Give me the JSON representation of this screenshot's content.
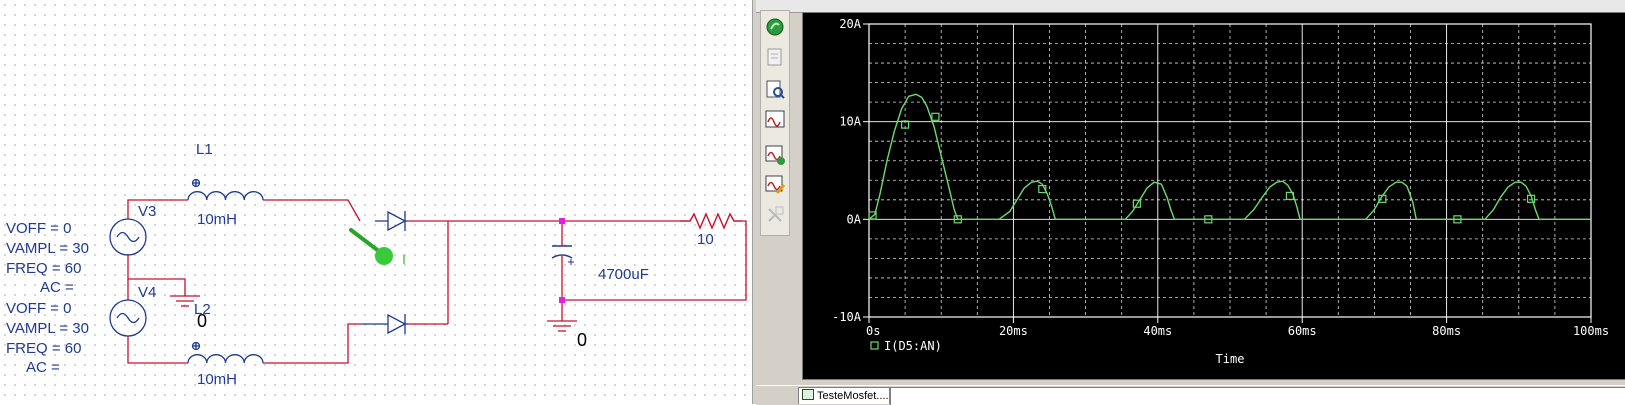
{
  "schematic": {
    "left_source_params": [
      "VOFF = 0",
      "VAMPL = 30",
      "FREQ = 60",
      "AC ="
    ],
    "left_source_params_2": [
      "VOFF = 0",
      "VAMPL = 30",
      "FREQ = 60",
      "AC ="
    ],
    "v3_label": "V3",
    "v4_label": "V4",
    "l1_name": "L1",
    "l1_value": "10mH",
    "l2_name": "L2",
    "l2_value": "10mH",
    "gnd_label_1": "0",
    "gnd_label_2": "0",
    "probe_label": "I",
    "cap_value": "4700uF",
    "res_value": "10",
    "wire_color": "#c8102e",
    "part_color": "#1f3a93",
    "probe_color": "#39c93a",
    "node_color": "#e020e0"
  },
  "toolbar": {
    "icons": [
      "run-sim-icon",
      "view-output-icon",
      "view-sim-results-icon",
      "add-trace-icon",
      "run-pspice-icon",
      "edit-profile-icon",
      "disabled-tool-icon"
    ]
  },
  "tabs": {
    "file_tab_label": "TesteMosfet...."
  },
  "chart_data": {
    "type": "line",
    "xlabel": "Time",
    "ylabel": "",
    "x_tick_labels": [
      "0s",
      "20ms",
      "40ms",
      "60ms",
      "80ms",
      "100ms"
    ],
    "y_tick_labels": [
      "-10A",
      "0A",
      "10A",
      "20A"
    ],
    "xlim": [
      0,
      100
    ],
    "ylim": [
      -10,
      20
    ],
    "grid": true,
    "legend_placement": "bottom-left",
    "background": "#000000",
    "trace_color": "#6bdc6b",
    "axis_color": "#ffffff",
    "series": [
      {
        "name": "I(D5:AN)",
        "x_ms": [
          0,
          0.8,
          1.5,
          2.5,
          3.5,
          4.5,
          5.5,
          6.5,
          7.3,
          8.0,
          9.0,
          10.0,
          11.0,
          11.8,
          12.3,
          12.8,
          18.0,
          19.5,
          20.5,
          21.5,
          22.5,
          23.3,
          24.0,
          24.7,
          25.3,
          25.8,
          35.5,
          36.5,
          37.5,
          38.5,
          39.5,
          40.5,
          41.3,
          41.8,
          42.3,
          52.0,
          53.3,
          54.5,
          55.5,
          56.5,
          57.3,
          58.0,
          58.7,
          59.3,
          59.7,
          68.8,
          70.0,
          71.0,
          72.0,
          73.0,
          73.8,
          74.5,
          75.3,
          75.8,
          85.3,
          86.5,
          87.5,
          88.5,
          89.5,
          90.3,
          91.0,
          91.7,
          92.3,
          92.8,
          100.0
        ],
        "y_amp": [
          0,
          0.5,
          2.5,
          6,
          9,
          11.3,
          12.6,
          12.8,
          12.5,
          11.6,
          9.5,
          6.5,
          3.5,
          1.0,
          0,
          0,
          0,
          0.8,
          2,
          3.2,
          3.8,
          3.9,
          3.6,
          2.6,
          1.3,
          0,
          0,
          0.8,
          2,
          3.2,
          3.8,
          3.6,
          2.2,
          1.0,
          0,
          0,
          1.0,
          2.3,
          3.3,
          3.8,
          3.9,
          3.5,
          2.6,
          1.2,
          0,
          0,
          1.0,
          2.3,
          3.3,
          3.8,
          3.8,
          3.4,
          1.8,
          0,
          0,
          1.0,
          2.3,
          3.3,
          3.8,
          3.8,
          3.4,
          2.4,
          1.0,
          0,
          0
        ],
        "marker_x_ms": [
          0.5,
          5.0,
          9.2,
          12.3,
          24.0,
          37.1,
          47.0,
          58.3,
          71.1,
          81.5,
          91.7
        ],
        "marker_y_amp": [
          0.4,
          9.7,
          10.5,
          0,
          3.1,
          1.6,
          0,
          2.4,
          2.1,
          0,
          2.1
        ]
      }
    ]
  }
}
